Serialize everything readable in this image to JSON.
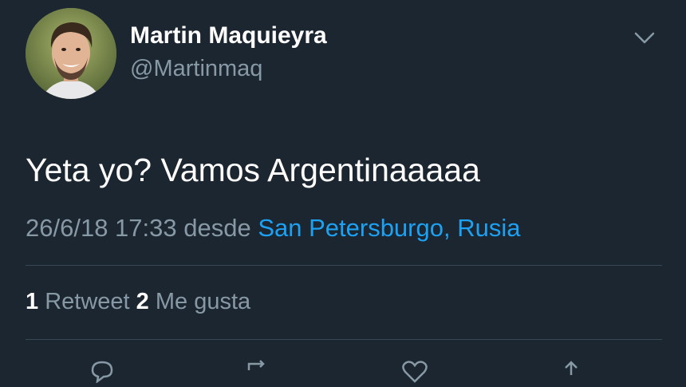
{
  "user": {
    "display_name": "Martin Maquieyra",
    "handle": "@Martinmaq"
  },
  "tweet": {
    "text": "Yeta yo? Vamos Argentinaaaaa",
    "timestamp": "26/6/18 17:33 desde",
    "location": "San Petersburgo, Rusia"
  },
  "stats": {
    "retweets_count": "1",
    "retweets_label": "Retweet",
    "likes_count": "2",
    "likes_label": "Me gusta"
  },
  "colors": {
    "background": "#1b2631",
    "link": "#1da1f2",
    "secondary_text": "#8899a6",
    "divider": "#3a4754"
  },
  "icons": {
    "menu": "chevron-down-icon",
    "reply": "reply-icon",
    "retweet": "retweet-icon",
    "like": "heart-icon",
    "share": "share-icon"
  }
}
